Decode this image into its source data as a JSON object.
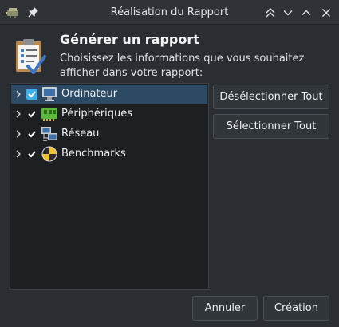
{
  "window": {
    "title": "Réalisation du Rapport"
  },
  "header": {
    "title": "Générer un rapport",
    "description": "Choisissez les informations que vous souhaitez afficher dans votre rapport:"
  },
  "tree": {
    "items": [
      {
        "label": "Ordinateur",
        "icon": "computer-icon",
        "checked": true,
        "selected": true
      },
      {
        "label": "Périphériques",
        "icon": "device-board-icon",
        "checked": true,
        "selected": false
      },
      {
        "label": "Réseau",
        "icon": "network-icon",
        "checked": true,
        "selected": false
      },
      {
        "label": "Benchmarks",
        "icon": "benchmark-icon",
        "checked": true,
        "selected": false
      }
    ]
  },
  "buttons": {
    "deselect_all": "Désélectionner Tout",
    "select_all": "Sélectionner Tout",
    "cancel": "Annuler",
    "create": "Création"
  },
  "colors": {
    "accent": "#3daee9",
    "selection": "#2c4a63",
    "background": "#2a2e32"
  }
}
